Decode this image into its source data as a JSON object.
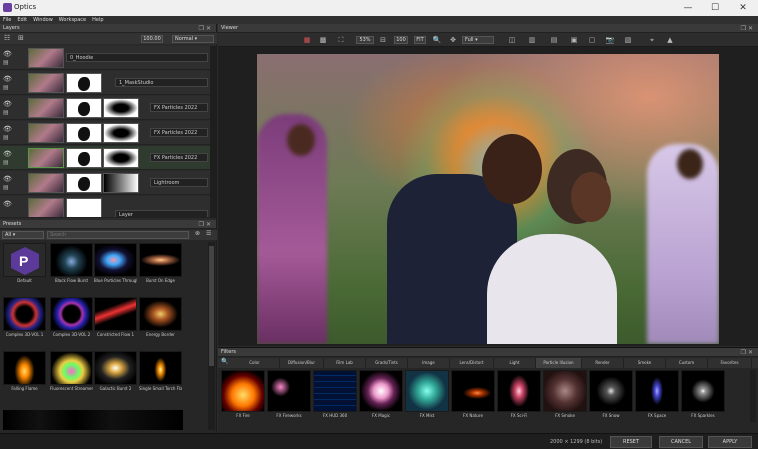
{
  "window": {
    "title": "Optics"
  },
  "menu": [
    "File",
    "Edit",
    "Window",
    "Workspace",
    "Help"
  ],
  "layers": {
    "header": "Layers",
    "opacity_value": "100.00",
    "blend_mode": "Normal",
    "rows": [
      {
        "name": "0_Hoodie"
      },
      {
        "name": "1_MaskStudio"
      },
      {
        "name": "FX Particles 2022"
      },
      {
        "name": "FX Particles 2022"
      },
      {
        "name": "FX Particles 2022"
      },
      {
        "name": "Lightroom"
      },
      {
        "name": "Layer"
      }
    ]
  },
  "presets": {
    "header": "Presets",
    "category": "All",
    "search_placeholder": "Search",
    "items": [
      {
        "label": "Default"
      },
      {
        "label": "Black Flow Burst"
      },
      {
        "label": "Blue Particles Through"
      },
      {
        "label": "Burst On Edge"
      },
      {
        "label": "Complex 3D-VOL 1"
      },
      {
        "label": "Complex 3D-VOL 2"
      },
      {
        "label": "Constricted Flow 1"
      },
      {
        "label": "Energy Border"
      },
      {
        "label": "Falling Flame"
      },
      {
        "label": "Fluorescent Streamer"
      },
      {
        "label": "Galactic Burst 2"
      },
      {
        "label": "Single Small Torch Flame"
      }
    ]
  },
  "viewer": {
    "header": "Viewer",
    "zoom": "53%",
    "fit_label": "FIT",
    "ratio_label": "100",
    "channel": "Full"
  },
  "filters": {
    "header": "Filters",
    "tabs": [
      "Color",
      "Diffusion/Blur",
      "Film Lab",
      "Grads/Tints",
      "Image",
      "Lens/Distort",
      "Light",
      "Particle Illusion",
      "Render",
      "Smoke",
      "Custom",
      "Favorites"
    ],
    "items": [
      {
        "label": "FX Fire"
      },
      {
        "label": "FX Fireworks"
      },
      {
        "label": "FX HUD 360"
      },
      {
        "label": "FX Magic"
      },
      {
        "label": "FX Mist"
      },
      {
        "label": "FX Nature"
      },
      {
        "label": "FX Sci-Fi"
      },
      {
        "label": "FX Smoke"
      },
      {
        "label": "FX Snow"
      },
      {
        "label": "FX Space"
      },
      {
        "label": "FX Sparkles"
      }
    ]
  },
  "status": {
    "dimensions": "2000 × 1299 (8 bits)",
    "reset": "RESET",
    "cancel": "CANCEL",
    "apply": "APPLY"
  },
  "colors": {
    "accent": "#6a3fa0",
    "panel": "#2a2a2a",
    "viewer_bg": "#1f1f1f"
  }
}
